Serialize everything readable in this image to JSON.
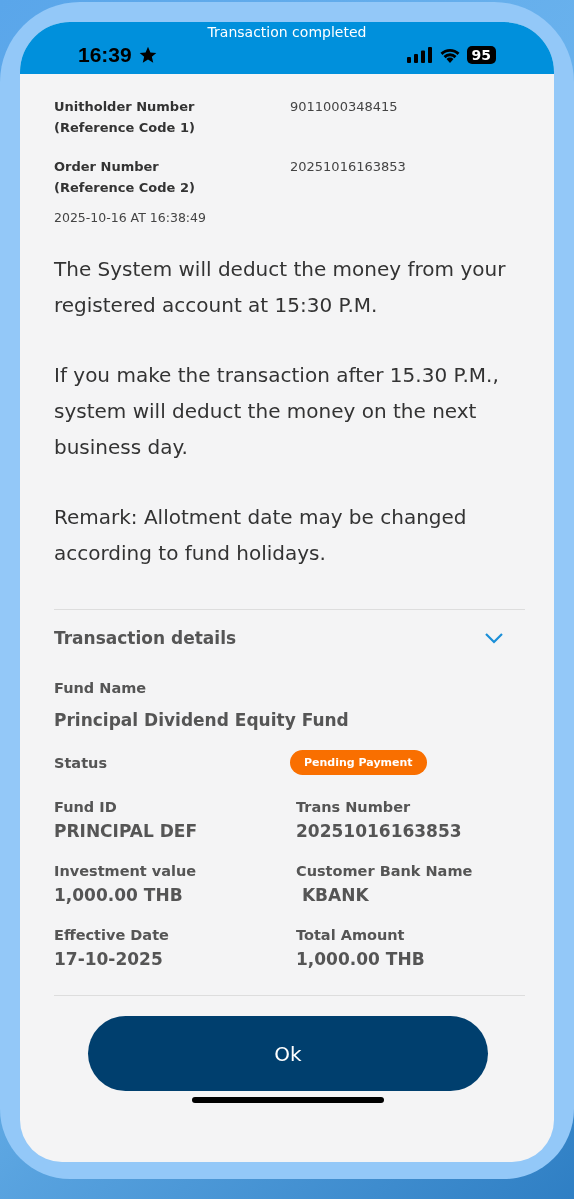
{
  "header": {
    "title": "Transaction completed"
  },
  "status_bar": {
    "time": "16:39",
    "battery": "95"
  },
  "references": [
    {
      "label": "Unitholder Number (Reference Code 1)",
      "value": "9011000348415"
    },
    {
      "label": "Order Number (Reference Code 2)",
      "value": "20251016163853"
    }
  ],
  "timestamp": "2025-10-16 AT 16:38:49",
  "notes": [
    "The System will deduct the money from your registered account at 15:30 P.M.",
    "If you make the transaction after 15.30 P.M., system will deduct the money on the next business day.",
    "Remark: Allotment date may be changed according to fund holidays."
  ],
  "details": {
    "title": "Transaction details",
    "expanded": true,
    "fund_name_label": "Fund Name",
    "fund_name": "Principal Dividend Equity Fund",
    "status_label": "Status",
    "status": "Pending Payment",
    "fields": [
      {
        "label": "Fund ID",
        "value": "PRINCIPAL DEF"
      },
      {
        "label": "Trans Number",
        "value": "20251016163853"
      },
      {
        "label": "Investment value",
        "value": "1,000.00 THB"
      },
      {
        "label": "Customer Bank Name",
        "value": " KBANK"
      },
      {
        "label": "Effective Date",
        "value": "17-10-2025"
      },
      {
        "label": "Total Amount",
        "value": "1,000.00 THB"
      }
    ]
  },
  "ok_button": "Ok"
}
